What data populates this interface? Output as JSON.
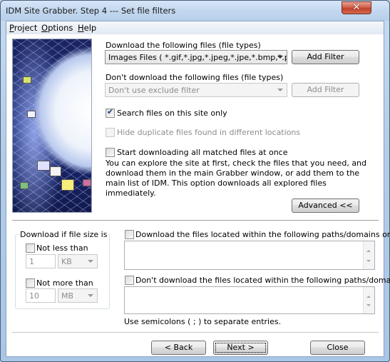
{
  "window": {
    "title": "IDM Site Grabber. Step 4 --- Set file filters",
    "close_label": "x"
  },
  "menu": {
    "items": [
      {
        "label": "Project",
        "accel": "P"
      },
      {
        "label": "Options",
        "accel": "O"
      },
      {
        "label": "Help",
        "accel": "H"
      }
    ]
  },
  "include": {
    "label": "Download the following files (file types)",
    "selected": "Images Files  ( *.gif,*.jpg,*.jpeg,*.jpe,*.bmp,*.png,*",
    "add_filter": "Add Filter"
  },
  "exclude": {
    "label": "Don't download the following files (file types)",
    "selected": "Don't use exclude filter",
    "add_filter": "Add Filter"
  },
  "options": {
    "search_site_only": {
      "label": "Search files on this site only",
      "checked": true
    },
    "hide_duplicates": {
      "label": "Hide duplicate files found in different locations",
      "checked": false,
      "disabled": true
    },
    "start_downloading": {
      "label": "Start downloading all matched files at once",
      "checked": false
    },
    "description": "You can explore the site at first, check the files that you need, and download them in the main Grabber window, or add them to the main list of IDM. This option downloads all explored files immediately."
  },
  "advanced_button": "Advanced <<",
  "size_filter": {
    "title": "Download if file size is",
    "not_less": {
      "label": "Not less than",
      "checked": false,
      "value": "1",
      "unit": "KB"
    },
    "not_more": {
      "label": "Not more than",
      "checked": false,
      "value": "10",
      "unit": "MB"
    }
  },
  "paths": {
    "include_label": "Download the files located within the following paths/domains only :",
    "include_checked": false,
    "include_value": "",
    "exclude_label": "Don't download the files located within the following paths/domains:",
    "exclude_checked": false,
    "exclude_value": "",
    "hint": "Use semicolons ( ; ) to separate entries."
  },
  "footer": {
    "back": "< Back",
    "next": "Next >",
    "close": "Close"
  }
}
